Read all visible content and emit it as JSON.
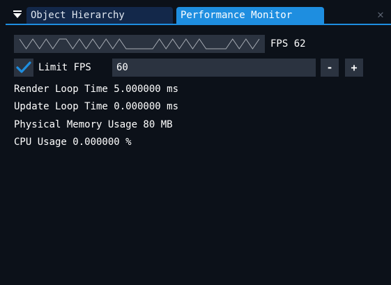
{
  "tabs": [
    {
      "label": "Object Hierarchy",
      "active": false
    },
    {
      "label": "Performance Monitor",
      "active": true
    }
  ],
  "close_icon": "close-icon",
  "collapse_icon": "triangle-down-icon",
  "fps_plot": {
    "label": "FPS 62",
    "values": [
      1,
      0,
      1,
      0,
      1,
      0,
      1,
      1,
      0,
      1,
      0,
      1,
      0,
      1,
      0,
      1,
      0,
      0,
      0,
      0,
      0,
      1,
      0,
      1,
      0,
      1,
      0,
      1,
      0,
      0,
      0,
      0,
      1,
      0,
      1,
      0,
      1
    ]
  },
  "limit_fps": {
    "checked": true,
    "label": "Limit FPS",
    "value": "60",
    "minus_label": "-",
    "plus_label": "+"
  },
  "stats": [
    "Render Loop Time 5.000000 ms",
    "Update Loop Time 0.000000 ms",
    "Physical Memory Usage 80 MB",
    "CPU Usage 0.000000 %"
  ],
  "colors": {
    "accent": "#1e8ee0",
    "inactive_tab": "#13284a",
    "frame_bg": "#2b3340",
    "window_bg": "#0c1119",
    "text": "#ffffff",
    "plot_line": "#a8adb5"
  }
}
